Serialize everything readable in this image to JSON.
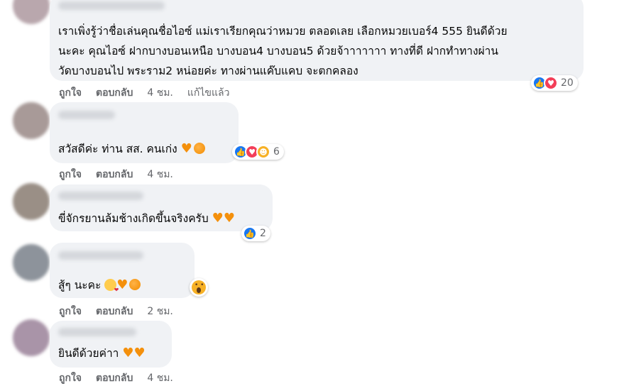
{
  "colors": {
    "bubble_bg": "#f0f2f5",
    "secondary_text": "#65676b",
    "like_blue": "#1877f2",
    "love_red": "#f33e58",
    "haha_yellow": "#f7b125"
  },
  "comments": [
    {
      "lines": [
        "เราเพิ่งรู้ว่าชื่อเล่นคุณชื่อไอซ์ แม่เราเรียกคุณว่าหมวย ตลอดเลย เลือกหมวยเบอร์4 555 ยินดีด้วย",
        "นะคะ คุณไอซ์ ฝากบางบอนเหนือ บางบอน4 บางบอน5 ด้วยจ้าาาาาาา ทางที่ดี ฝากทำทางผ่าน",
        "วัดบางบอนไป พระราม2 หน่อยค่ะ ทางผ่านแค๊บแคบ จะตกคลอง"
      ],
      "like": "ถูกใจ",
      "reply": "ตอบกลับ",
      "time": "4 ชม.",
      "edited": "แก้ไขแล้ว",
      "reaction_icons": [
        "like-icon",
        "love-icon"
      ],
      "reaction_count": "20"
    },
    {
      "lines": [
        "สวัสดีค่ะ ท่าน สส. คนเก่ง"
      ],
      "emojis": [
        "orange-heart-icon",
        "tangerine-icon"
      ],
      "like": "ถูกใจ",
      "reply": "ตอบกลับ",
      "time": "4 ชม.",
      "reaction_icons": [
        "like-icon",
        "love-icon",
        "care-icon"
      ],
      "reaction_count": "6"
    },
    {
      "lines": [
        "ขี่จักรยานล้มช้างเกิดขึ้นจริงครับ"
      ],
      "emojis": [
        "orange-heart-icon",
        "orange-heart-icon"
      ],
      "reaction_icons": [
        "like-icon"
      ],
      "reaction_count": "2"
    },
    {
      "lines": [
        "สู้ๆ นะคะ"
      ],
      "emojis": [
        "kissing-heart-icon",
        "orange-heart-icon",
        "tangerine-icon"
      ],
      "like": "ถูกใจ",
      "reply": "ตอบกลับ",
      "time": "2 ชม.",
      "reaction_icons": [
        "wow-icon"
      ]
    },
    {
      "lines": [
        "ยินดีด้วยค่าา"
      ],
      "emojis": [
        "orange-heart-icon",
        "orange-heart-icon"
      ],
      "like": "ถูกใจ",
      "reply": "ตอบกลับ",
      "time": "4 ชม."
    }
  ]
}
